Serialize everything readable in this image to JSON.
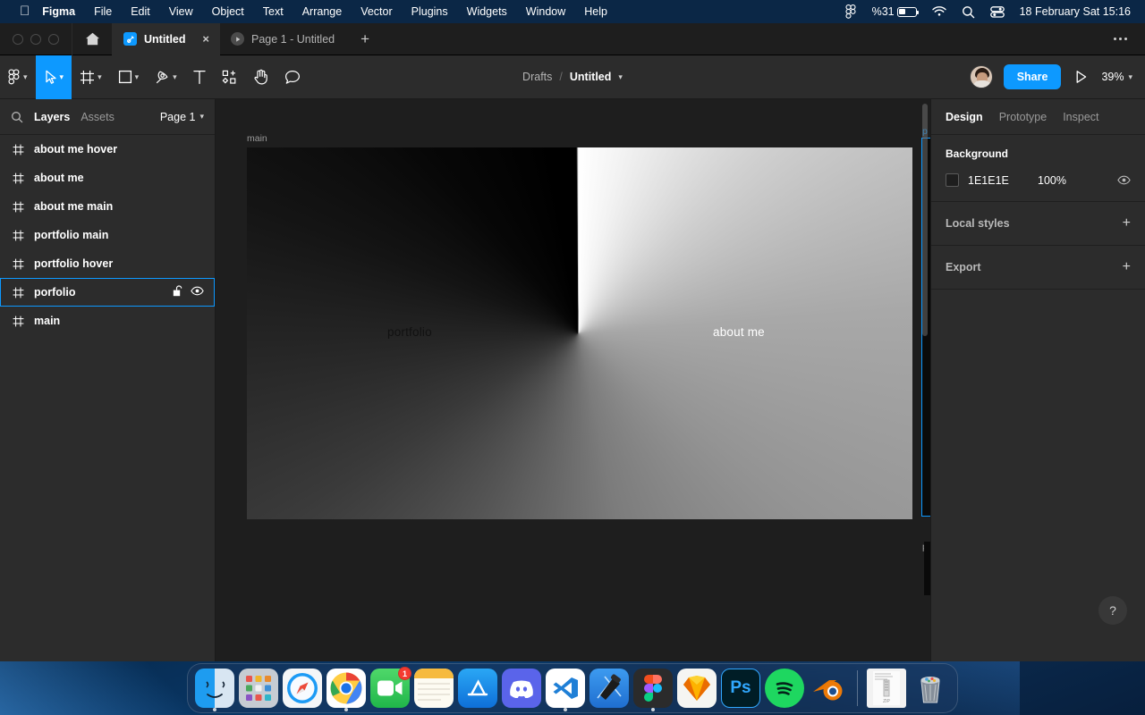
{
  "menubar": {
    "apple_icon": "apple-logo-icon",
    "items": [
      {
        "label": "Figma",
        "bold": true
      },
      {
        "label": "File",
        "bold": false
      },
      {
        "label": "Edit",
        "bold": false
      },
      {
        "label": "View",
        "bold": false
      },
      {
        "label": "Object",
        "bold": false
      },
      {
        "label": "Text",
        "bold": false
      },
      {
        "label": "Arrange",
        "bold": false
      },
      {
        "label": "Vector",
        "bold": false
      },
      {
        "label": "Plugins",
        "bold": false
      },
      {
        "label": "Widgets",
        "bold": false
      },
      {
        "label": "Window",
        "bold": false
      },
      {
        "label": "Help",
        "bold": false
      }
    ],
    "status": {
      "figma_icon": "figma-menu-icon",
      "battery_percent": "%31",
      "wifi_icon": "wifi-icon",
      "search_icon": "spotlight-search-icon",
      "control_center_icon": "control-center-icon",
      "datetime": "18 February Sat  15:16"
    }
  },
  "tabbar": {
    "home_icon": "home-icon",
    "tabs": [
      {
        "label": "Untitled",
        "icon": "figma-file-icon",
        "close": "×",
        "active": true
      },
      {
        "label": "Page 1 - Untitled",
        "icon": "prototype-play-icon",
        "active": false
      }
    ],
    "new_tab_label": "+",
    "more_icon": "more-options-icon"
  },
  "toolbar": {
    "tools": [
      {
        "name": "figma-menu-tool",
        "icon": "figma-logo-icon",
        "caret": true,
        "selected": false
      },
      {
        "name": "move-tool",
        "icon": "cursor-arrow-icon",
        "caret": true,
        "selected": true
      },
      {
        "name": "frame-tool",
        "icon": "frame-icon",
        "caret": true,
        "selected": false
      },
      {
        "name": "shape-tool",
        "icon": "rectangle-icon",
        "caret": true,
        "selected": false
      },
      {
        "name": "pen-tool",
        "icon": "pen-icon",
        "caret": true,
        "selected": false
      },
      {
        "name": "text-tool",
        "icon": "text-t-icon",
        "caret": false,
        "selected": false
      },
      {
        "name": "resources-tool",
        "icon": "components-icon",
        "caret": false,
        "selected": false
      },
      {
        "name": "hand-tool",
        "icon": "hand-icon",
        "caret": false,
        "selected": false
      },
      {
        "name": "comment-tool",
        "icon": "comment-bubble-icon",
        "caret": false,
        "selected": false
      }
    ],
    "breadcrumb": {
      "project": "Drafts",
      "separator": "/",
      "file": "Untitled",
      "caret_icon": "chevron-down-icon"
    },
    "avatar_name": "user-avatar",
    "share_label": "Share",
    "present_icon": "present-play-icon",
    "zoom_level": "39%"
  },
  "left_panel": {
    "search_icon": "search-icon",
    "tabs": [
      {
        "label": "Layers",
        "active": true
      },
      {
        "label": "Assets",
        "active": false
      }
    ],
    "page_selector": "Page 1",
    "page_caret_icon": "chevron-down-icon",
    "layers": [
      {
        "name": "about me hover",
        "icon": "frame-icon",
        "selected": false
      },
      {
        "name": "about me",
        "icon": "frame-icon",
        "selected": false
      },
      {
        "name": "about me main",
        "icon": "frame-icon",
        "selected": false
      },
      {
        "name": "portfolio main",
        "icon": "frame-icon",
        "selected": false
      },
      {
        "name": "portfolio hover",
        "icon": "frame-icon",
        "selected": false
      },
      {
        "name": "porfolio",
        "icon": "frame-icon",
        "selected": true,
        "lock_icon": "unlock-icon",
        "visibility_icon": "eye-icon"
      },
      {
        "name": "main",
        "icon": "frame-icon",
        "selected": false
      }
    ]
  },
  "right_panel": {
    "tabs": [
      {
        "label": "Design",
        "active": true
      },
      {
        "label": "Prototype",
        "active": false
      },
      {
        "label": "Inspect",
        "active": false
      }
    ],
    "background": {
      "title": "Background",
      "color_hex": "1E1E1E",
      "swatch_color": "#1E1E1E",
      "opacity": "100%",
      "visibility_icon": "eye-icon"
    },
    "local_styles": {
      "label": "Local styles",
      "add_icon": "plus-icon"
    },
    "export": {
      "label": "Export",
      "add_icon": "plus-icon"
    },
    "help_label": "?"
  },
  "canvas": {
    "frame_label": "main",
    "design_texts": [
      {
        "text": "portfolio",
        "color": "#111111"
      },
      {
        "text": "about me",
        "color": "#FFFFFF"
      }
    ],
    "offscreen_frame_labels": [
      "p",
      "p"
    ],
    "accent_color": "#0D99FF",
    "background_color": "#1E1E1E"
  },
  "dock": {
    "apps": [
      {
        "name": "finder",
        "running": true
      },
      {
        "name": "launchpad",
        "running": false
      },
      {
        "name": "safari",
        "running": false
      },
      {
        "name": "google-chrome",
        "running": true
      },
      {
        "name": "facetime",
        "running": false,
        "badge": "1"
      },
      {
        "name": "notes",
        "running": false
      },
      {
        "name": "app-store",
        "running": false
      },
      {
        "name": "discord",
        "running": false
      },
      {
        "name": "visual-studio-code",
        "running": true
      },
      {
        "name": "xcode",
        "running": false
      },
      {
        "name": "figma",
        "running": true
      },
      {
        "name": "sketch",
        "running": false
      },
      {
        "name": "photoshop",
        "running": false
      },
      {
        "name": "spotify",
        "running": false
      },
      {
        "name": "blender",
        "running": false
      }
    ],
    "files": [
      {
        "name": "zip-archive-file",
        "label": "ZIP"
      },
      {
        "name": "trash",
        "label": ""
      }
    ]
  }
}
